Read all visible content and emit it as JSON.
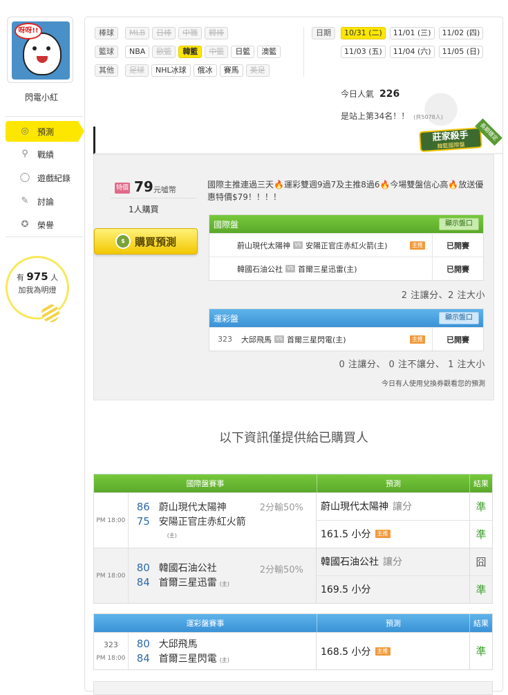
{
  "sidebar": {
    "avatar_bubble": "呀呀!!",
    "username": "閃電小紅",
    "nav": [
      {
        "label": "預測",
        "icon": "target-icon",
        "active": true
      },
      {
        "label": "戰績",
        "icon": "magnifier-icon",
        "active": false
      },
      {
        "label": "遊戲紀錄",
        "icon": "circle-icon",
        "active": false
      },
      {
        "label": "討論",
        "icon": "chat-icon",
        "active": false
      },
      {
        "label": "榮譽",
        "icon": "medal-icon",
        "active": false
      }
    ],
    "fans_prefix": "有",
    "fans_count": "975",
    "fans_suffix": "人",
    "fans_text": "加我為明燈"
  },
  "filters": {
    "baseball": {
      "label": "棒球",
      "tags": [
        "MLB",
        "日棒",
        "中職",
        "韓棒"
      ]
    },
    "basketball": {
      "label": "籃球",
      "tags": [
        "NBA",
        "歐籃",
        "韓籃",
        "中籃",
        "日籃",
        "澳籃"
      ]
    },
    "other": {
      "label": "其他",
      "tags": [
        "足球",
        "NHL冰球",
        "俄冰",
        "賽馬",
        "美足"
      ]
    }
  },
  "dates": {
    "label": "日期",
    "row1": [
      "10/31 (二)",
      "11/01 (三)",
      "11/02 (四)"
    ],
    "row2": [
      "11/03 (五)",
      "11/04 (六)",
      "11/05 (日)"
    ]
  },
  "popularity": {
    "label": "今日人氣",
    "value": "226",
    "rank_text": "是站上第34名！！",
    "rank_total": "(共5078人)"
  },
  "badge": {
    "title": "莊家殺手",
    "subtitle": "韓籃國際盤",
    "ribbon": "長期穩定"
  },
  "prediction": {
    "price_tag": "特價",
    "price": "79",
    "price_unit": "元噓幣",
    "buyers": "1人購買",
    "buy_button": "購買預測",
    "description": "國際主推連過三天🔥運彩雙週9過7及主推8過6🔥今場雙盤信心高🔥放送優惠特價$79！！！！",
    "intl": {
      "title": "國際盤",
      "show_btn": "顯示盤口",
      "rows": [
        {
          "home": "蔚山現代太陽神",
          "away": "安陽正官庄赤紅火箭(主)",
          "main": "主推",
          "status": "已開賽"
        },
        {
          "home": "韓國石油公社",
          "away": "首爾三星迅雷(主)",
          "main": "",
          "status": "已開賽"
        }
      ],
      "summary": "2 注讓分、2 注大小"
    },
    "lottery": {
      "title": "運彩盤",
      "show_btn": "顯示盤口",
      "rows": [
        {
          "no": "323",
          "home": "大邱飛馬",
          "away": "首爾三星閃電(主)",
          "main": "主推",
          "status": "已開賽"
        }
      ],
      "summary": "0 注讓分、 0 注不讓分、 1 注大小"
    },
    "ticket_note": "今日有人使用兌換券觀看您的預測",
    "vs_label": "VS"
  },
  "only_buyers": "以下資訊僅提供給已購買人",
  "intl_results": {
    "headers": [
      "國際盤賽事",
      "預測",
      "結果"
    ],
    "matches": [
      {
        "time": "PM 18:00",
        "home_score": "86",
        "home": "蔚山現代太陽神",
        "away_score": "75",
        "away": "安陽正官庄赤紅火箭",
        "host": "(主)",
        "odds": "2分輸50%",
        "picks": [
          {
            "pick": "蔚山現代太陽神",
            "type": "讓分",
            "main": "",
            "result": "準"
          },
          {
            "pick": "161.5 小分",
            "type": "",
            "main": "主推",
            "result": "準"
          }
        ]
      },
      {
        "time": "PM 18:00",
        "home_score": "80",
        "home": "韓國石油公社",
        "away_score": "84",
        "away": "首爾三星迅雷",
        "host": "(主)",
        "odds": "2分輸50%",
        "picks": [
          {
            "pick": "韓國石油公社",
            "type": "讓分",
            "main": "",
            "result": "囧"
          },
          {
            "pick": "169.5 小分",
            "type": "",
            "main": "",
            "result": "準"
          }
        ]
      }
    ]
  },
  "lottery_results": {
    "headers": [
      "運彩盤賽事",
      "預測",
      "結果"
    ],
    "matches": [
      {
        "no": "323",
        "time": "PM 18:00",
        "home_score": "80",
        "home": "大邱飛馬",
        "away_score": "84",
        "away": "首爾三星閃電",
        "host": "(主)",
        "picks": [
          {
            "pick": "168.5 小分",
            "main": "主推",
            "result": "準"
          }
        ]
      }
    ]
  }
}
